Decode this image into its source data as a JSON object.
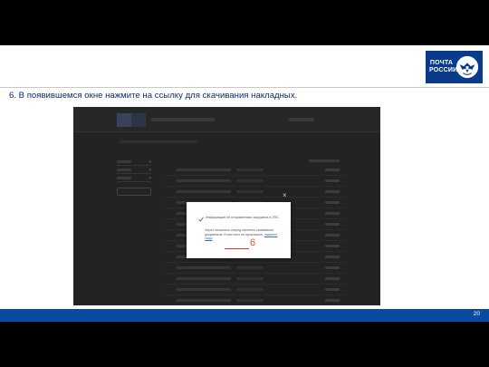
{
  "logo": {
    "line1": "ПОЧТА",
    "line2": "РОССИИ",
    "brand_color": "#0a3a8c"
  },
  "instruction": "6. В появившемся окне нажмите на ссылку для скачивания накладных.",
  "modal": {
    "title": "Информация об отправлениях загружена в ЛПС.",
    "body_before_link": "Через несколько секунд начнется скачивание документов. Если этого не произошло, ",
    "link_text": "нажмите сюда",
    "close_icon": "×",
    "check_icon": "check-icon"
  },
  "callout": {
    "number": "6",
    "color": "#e03a2a"
  },
  "footer": {
    "page_number": "20",
    "color": "#0b4aa2"
  }
}
